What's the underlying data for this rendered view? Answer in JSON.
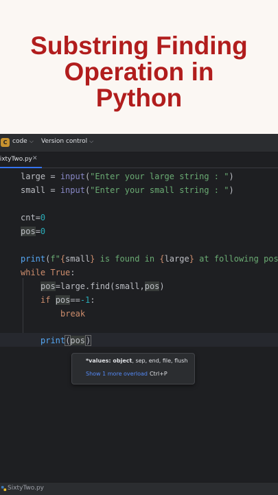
{
  "banner": {
    "title_line1": "Substring Finding",
    "title_line2": "Operation in",
    "title_line3": "Python",
    "color": "#b11d1d"
  },
  "toolbar": {
    "project_badge": "C",
    "project_name": "code",
    "vcs_label": "Version control"
  },
  "tab": {
    "label": "SixtyTwo.py",
    "close": "✕"
  },
  "code": {
    "l1_var": "large",
    "l1_eq": " = ",
    "l1_fn": "input",
    "l1_open": "(",
    "l1_str": "\"Enter your large string : \"",
    "l1_close": ")",
    "l2_var": "small",
    "l2_eq": " = ",
    "l2_fn": "input",
    "l2_open": "(",
    "l2_str": "\"Enter your small string : \"",
    "l2_close": ")",
    "l3_var": "cnt",
    "l3_eq": "=",
    "l3_num": "0",
    "l4_var": "pos",
    "l4_eq": "=",
    "l4_num": "0",
    "l5_fn": "print",
    "l5_open": "(",
    "l5_f": "f\"",
    "l5_b1o": "{",
    "l5_v1": "small",
    "l5_b1c": "}",
    "l5_mid": " is found in ",
    "l5_b2o": "{",
    "l5_v2": "large",
    "l5_b2c": "}",
    "l5_tail": " at following pos",
    "l6_kw": "while",
    "l6_kw2": "True",
    "l6_colon": ":",
    "l7_var": "pos",
    "l7_rest": "=large.find(small,",
    "l7_arg": "pos",
    "l7_close": ")",
    "l8_kw": "if",
    "l8_var": "pos",
    "l8_op": "==",
    "l8_num": "-1",
    "l8_colon": ":",
    "l9_kw": "break",
    "l10_fn": "print",
    "l10_open": "(",
    "l10_var": "pos",
    "l10_close": ")"
  },
  "popup": {
    "signature_bold": "*values: object",
    "signature_rest": ", sep, end, file, flush",
    "overload_link": "Show 1 more overload",
    "shortcut": "Ctrl+P"
  },
  "status": {
    "file": "SixtyTwo.py"
  }
}
